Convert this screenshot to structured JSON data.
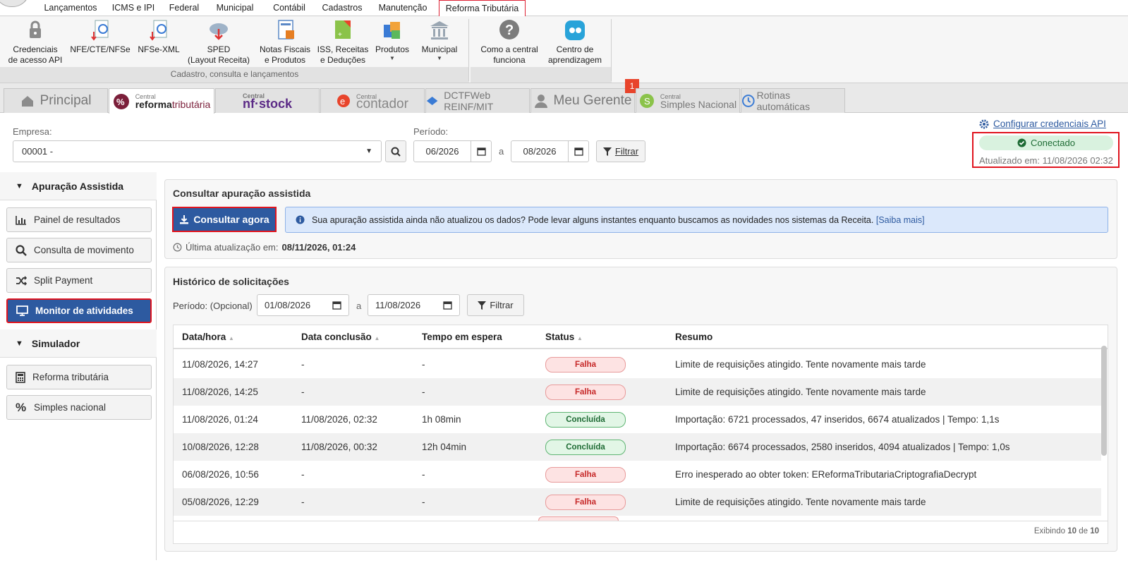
{
  "menu": {
    "items": [
      "Lançamentos",
      "ICMS e IPI",
      "Federal",
      "Municipal",
      "Contábil",
      "Cadastros",
      "Manutenção",
      "Reforma Tributária"
    ]
  },
  "ribbon": {
    "buttons": [
      {
        "label1": "Credenciais",
        "label2": "de acesso API"
      },
      {
        "label1": "NFE/CTE/NFSe",
        "label2": ""
      },
      {
        "label1": "NFSe-XML",
        "label2": ""
      },
      {
        "label1": "SPED",
        "label2": "(Layout Receita)"
      },
      {
        "label1": "Notas Fiscais",
        "label2": "e Produtos"
      },
      {
        "label1": "ISS, Receitas",
        "label2": "e Deduções"
      },
      {
        "label1": "Produtos",
        "label2": ""
      },
      {
        "label1": "Municipal",
        "label2": ""
      },
      {
        "label1": "Como a central",
        "label2": "funciona"
      },
      {
        "label1": "Centro de",
        "label2": "aprendizagem"
      }
    ],
    "group_label": "Cadastro, consulta e lançamentos"
  },
  "tabs": {
    "principal": "Principal",
    "reforma_small": "Central",
    "reforma_a": "reforma",
    "reforma_b": "tributária",
    "nfstock_small": "Central",
    "nfstock": "nf·stock",
    "contador_small": "Central",
    "contador": "contador",
    "dctf": "DCTFWeb REINF/MIT",
    "gerente": "Meu Gerente",
    "simples_small": "Central",
    "simples": "Simples Nacional",
    "rotinas": "Rotinas automáticas",
    "badge": "1"
  },
  "filters": {
    "empresa_label": "Empresa:",
    "empresa_value": "00001 -",
    "periodo_label": "Período:",
    "de": "06/2026",
    "a_label": "a",
    "ate": "08/2026",
    "filtrar": "Filtrar"
  },
  "connection": {
    "config_link": "Configurar credenciais API",
    "status": "Conectado",
    "updated": "Atualizado em: 11/08/2026 02:32"
  },
  "sidebar": {
    "section1": "Apuração Assistida",
    "items1": [
      "Painel de resultados",
      "Consulta de movimento",
      "Split Payment",
      "Monitor de atividades"
    ],
    "section2": "Simulador",
    "items2": [
      "Reforma tributária",
      "Simples nacional"
    ]
  },
  "consulta": {
    "title": "Consultar apuração assistida",
    "button": "Consultar agora",
    "info": "Sua apuração assistida ainda não atualizou os dados? Pode levar alguns instantes enquanto buscamos as novidades nos sistemas da Receita.",
    "info_link": "[Saiba mais]",
    "last_label": "Última atualização em:",
    "last_value": "08/11/2026, 01:24"
  },
  "historico": {
    "title": "Histórico de solicitações",
    "periodo_label": "Período: (Opcional)",
    "de": "01/08/2026",
    "a_label": "a",
    "ate": "11/08/2026",
    "filtrar": "Filtrar",
    "columns": [
      "Data/hora",
      "Data conclusão",
      "Tempo em espera",
      "Status",
      "Resumo"
    ],
    "rows": [
      {
        "data": "11/08/2026, 14:27",
        "conclusao": "-",
        "espera": "-",
        "status": "Falha",
        "resumo": "Limite de requisições atingido. Tente novamente mais tarde"
      },
      {
        "data": "11/08/2026, 14:25",
        "conclusao": "-",
        "espera": "-",
        "status": "Falha",
        "resumo": "Limite de requisições atingido. Tente novamente mais tarde"
      },
      {
        "data": "11/08/2026, 01:24",
        "conclusao": "11/08/2026, 02:32",
        "espera": "1h 08min",
        "status": "Concluída",
        "resumo": "Importação: 6721 processados, 47 inseridos, 6674 atualizados | Tempo: 1,1s"
      },
      {
        "data": "10/08/2026, 12:28",
        "conclusao": "11/08/2026, 00:32",
        "espera": "12h 04min",
        "status": "Concluída",
        "resumo": "Importação: 6674 processados, 2580 inseridos, 4094 atualizados | Tempo: 1,0s"
      },
      {
        "data": "06/08/2026, 10:56",
        "conclusao": "-",
        "espera": "-",
        "status": "Falha",
        "resumo": "Erro inesperado ao obter token: EReformaTributariaCriptografiaDecrypt"
      },
      {
        "data": "05/08/2026, 12:29",
        "conclusao": "-",
        "espera": "-",
        "status": "Falha",
        "resumo": "Limite de requisições atingido. Tente novamente mais tarde"
      }
    ],
    "footer_prefix": "Exibindo",
    "footer_shown": "10",
    "footer_of": "de",
    "footer_total": "10"
  },
  "colors": {
    "primary": "#2d5aa0",
    "highlight": "#e0141e",
    "success": "#1e6b34",
    "danger": "#c62828"
  }
}
